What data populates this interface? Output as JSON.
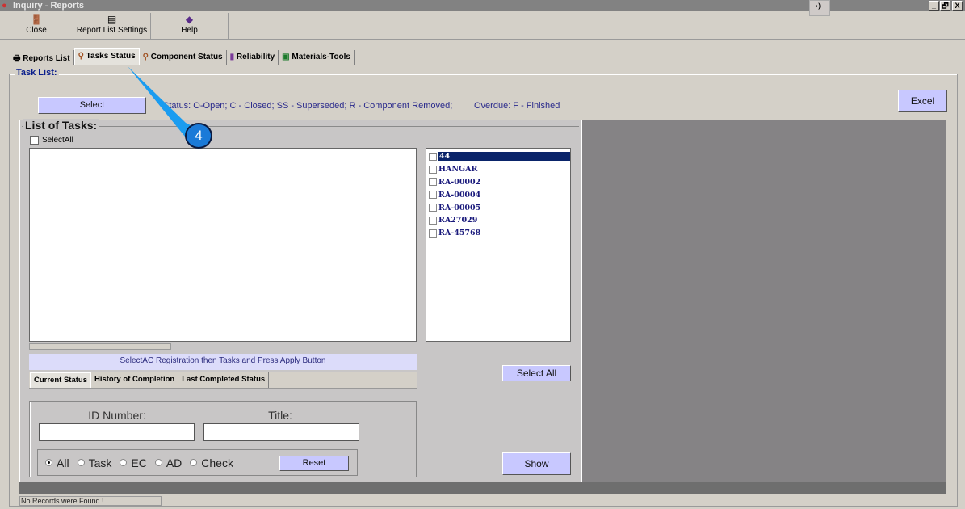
{
  "window": {
    "title": "Inquiry - Reports",
    "minimize": "_",
    "restore": "🗗",
    "close": "X"
  },
  "toolbar": [
    {
      "label": "Close",
      "icon": "door-exit-icon"
    },
    {
      "label": "Report List Settings",
      "icon": "list-settings-icon"
    },
    {
      "label": "Help",
      "icon": "help-book-icon"
    }
  ],
  "tabs": [
    {
      "label": "Reports List",
      "icon": "printer-icon"
    },
    {
      "label": "Tasks Status",
      "icon": "people-search-icon",
      "active": true
    },
    {
      "label": "Component Status",
      "icon": "people-search-icon"
    },
    {
      "label": "Reliability",
      "icon": "bar-chart-icon"
    },
    {
      "label": "Materials-Tools",
      "icon": "excel-icon"
    }
  ],
  "task_list": {
    "legend": "Task List:",
    "select_button": "Select",
    "status_legend": "Status: O-Open; C - Closed; SS - Superseded; R - Component Removed;",
    "overdue_legend": "Overdue: F - Finished",
    "excel_button": "Excel"
  },
  "list_of_tasks": {
    "legend": "List of Tasks:",
    "select_all_checkbox": "SelectAll",
    "hint": "SelectAC Registration then Tasks and Press Apply Button",
    "subtabs": [
      "Current Status",
      "History of Completion",
      "Last Completed Status"
    ],
    "id_number_label": "ID Number:",
    "id_number_value": "",
    "title_label": "Title:",
    "title_value": "",
    "filters": [
      {
        "label": "All",
        "checked": true
      },
      {
        "label": "Task"
      },
      {
        "label": "EC"
      },
      {
        "label": "AD"
      },
      {
        "label": "Check"
      }
    ],
    "reset_button": "Reset"
  },
  "registrations": [
    "44",
    "HANGAR",
    "RA-00002",
    "RA-00004",
    "RA-00005",
    "RA27029",
    "RA-45768"
  ],
  "select_all_button": "Select All",
  "show_button": "Show",
  "callout": "4",
  "status_bar": "No Records were Found !"
}
